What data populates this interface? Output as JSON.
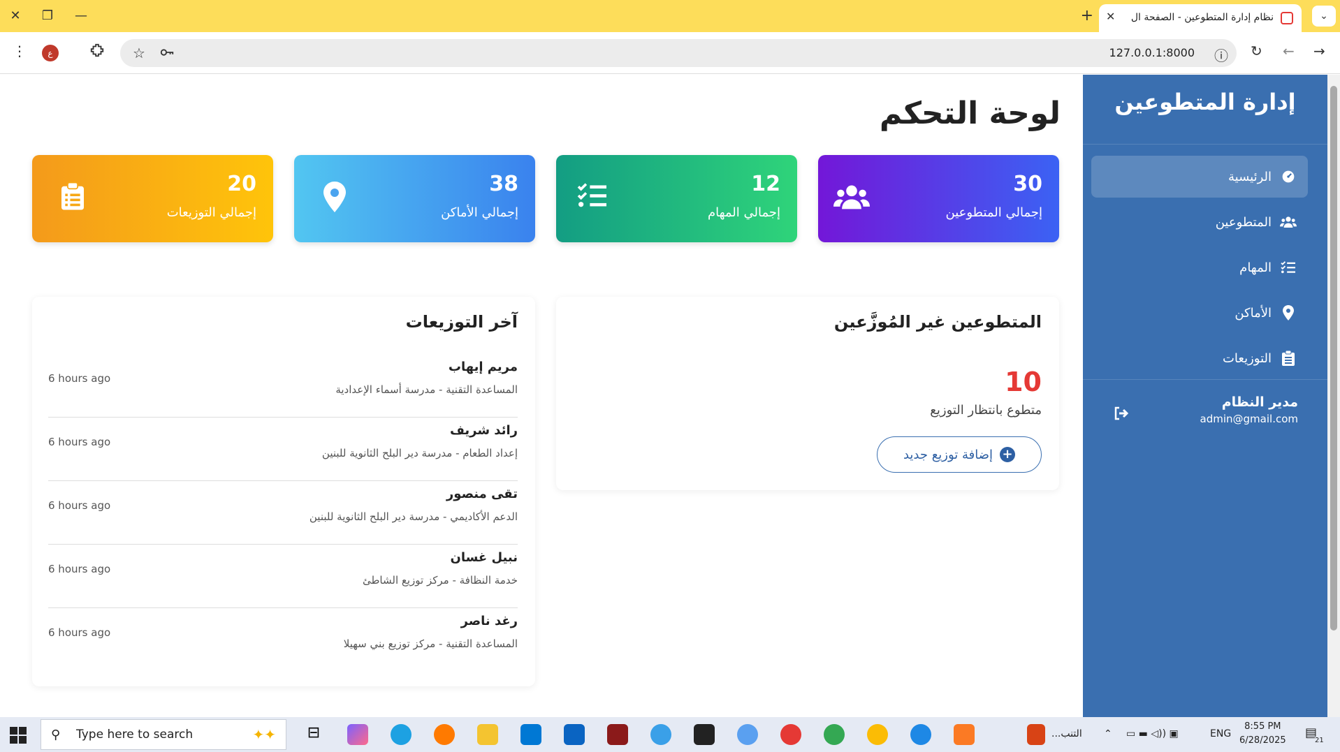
{
  "browser": {
    "tab_title": "نظام إدارة المتطوعين - الصفحة ال",
    "url": "127.0.0.1:8000",
    "profile_initial": "ع",
    "new_tab": "+",
    "close": "✕"
  },
  "sidebar": {
    "brand": "إدارة المتطوعين",
    "items": [
      {
        "label": "الرئيسية",
        "icon": "dashboard-icon",
        "active": true
      },
      {
        "label": "المتطوعين",
        "icon": "users-icon"
      },
      {
        "label": "المهام",
        "icon": "tasks-icon"
      },
      {
        "label": "الأماكن",
        "icon": "location-pin-icon"
      },
      {
        "label": "التوزيعات",
        "icon": "clipboard-icon"
      }
    ],
    "user": {
      "name": "مدير النظام",
      "email": "admin@gmail.com"
    }
  },
  "header": {
    "title": "لوحة التحكم"
  },
  "stats": [
    {
      "value": "30",
      "label": "إجمالي المتطوعين",
      "icon": "users-icon"
    },
    {
      "value": "12",
      "label": "إجمالي المهام",
      "icon": "tasks-icon"
    },
    {
      "value": "38",
      "label": "إجمالي الأماكن",
      "icon": "location-pin-icon"
    },
    {
      "value": "20",
      "label": "إجمالي التوزيعات",
      "icon": "clipboard-icon"
    }
  ],
  "unassigned": {
    "title": "المتطوعين غير المُوزَّعين",
    "count": "10",
    "caption": "متطوع بانتظار التوزيع",
    "button": "إضافة توزيع جديد"
  },
  "recent": {
    "title": "آخر التوزيعات",
    "items": [
      {
        "name": "مريم إيهاب",
        "detail": "المساعدة التقنية - مدرسة أسماء الإعدادية",
        "time": "6 hours ago"
      },
      {
        "name": "رائد شريف",
        "detail": "إعداد الطعام - مدرسة دير البلح الثانوية للبنين",
        "time": "6 hours ago"
      },
      {
        "name": "تقى منصور",
        "detail": "الدعم الأكاديمي - مدرسة دير البلح الثانوية للبنين",
        "time": "6 hours ago"
      },
      {
        "name": "نبيل غسان",
        "detail": "خدمة النظافة - مركز توزيع الشاطئ",
        "time": "6 hours ago"
      },
      {
        "name": "رغد ناصر",
        "detail": "المساعدة التقنية - مركز توزيع بني سهيلا",
        "time": "6 hours ago"
      }
    ]
  },
  "taskbar": {
    "search_placeholder": "Type here to search",
    "lang": "ENG",
    "time": "8:55 PM",
    "date": "6/28/2025",
    "app_label": "التنب...",
    "notifications": "21"
  },
  "colors": {
    "sidebar": "#3a6fb0",
    "accent_red": "#e53935"
  }
}
